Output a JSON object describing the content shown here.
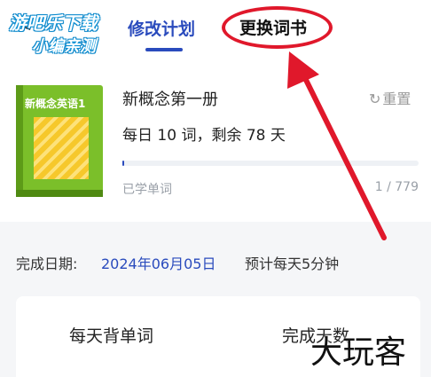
{
  "header": {
    "back_glyph": "<",
    "watermark_line1": "游吧乐下载",
    "watermark_line2": "小编亲测",
    "tab_plan": "修改计划",
    "tab_change_book": "更换词书"
  },
  "book": {
    "cover_title": "新概念英语1",
    "name": "新概念第一册",
    "reset_icon": "refresh-icon",
    "reset_label": "重置",
    "daily_text": "每日 10 词，剩余 78 天",
    "progress_fraction": 0.0013,
    "learned_label": "已学单词",
    "learned_count": "1 / 779"
  },
  "plan": {
    "finish_label": "完成日期:",
    "finish_date": "2024年06月05日",
    "estimate": "预计每天5分钟",
    "col_words": "每天背单词",
    "col_days": "完成天数"
  },
  "watermark_bottom": "大玩客",
  "annotation_color": "#e0182b",
  "accent_color": "#2a4bbd"
}
